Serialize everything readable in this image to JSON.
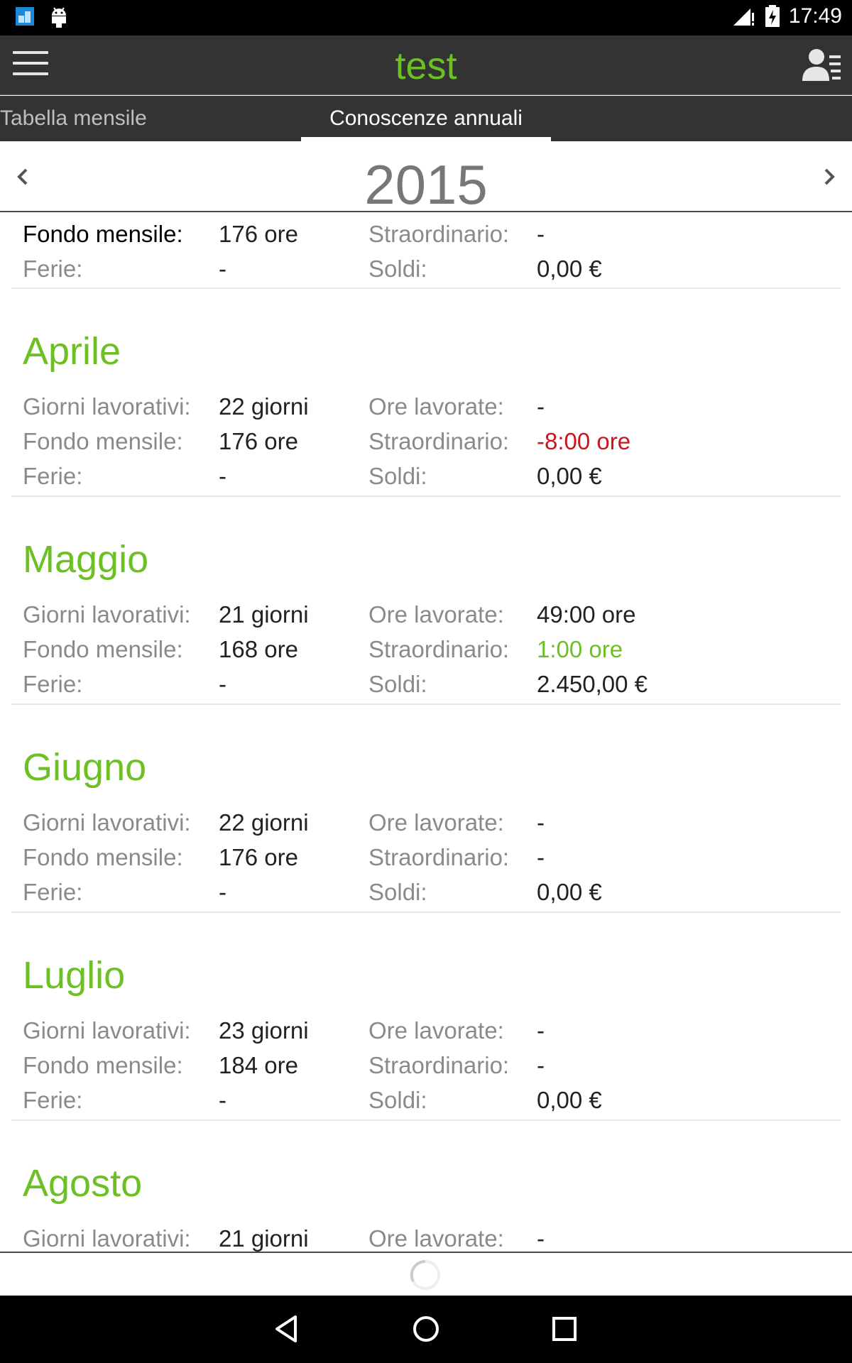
{
  "status_bar": {
    "time": "17:49",
    "icons": [
      "app-icon",
      "android-icon",
      "signal-icon",
      "battery-charging-icon"
    ]
  },
  "app_bar": {
    "title": "test",
    "menu_icon": "menu-icon",
    "profile_icon": "profile-list-icon"
  },
  "tabs": [
    {
      "label": "Tabella mensile",
      "active": false
    },
    {
      "label": "Conoscenze annuali",
      "active": true
    }
  ],
  "year_nav": {
    "year": "2015",
    "prev_icon": "chevron-left-icon",
    "next_icon": "chevron-right-icon"
  },
  "partial_month": {
    "rows": [
      {
        "l1": "Fondo mensile:",
        "v1": "176 ore",
        "l2": "Straordinario:",
        "v2": "-"
      },
      {
        "l1": "Ferie:",
        "v1": "-",
        "l2": "Soldi:",
        "v2": "0,00 €"
      }
    ]
  },
  "months": [
    {
      "name": "Aprile",
      "rows": [
        {
          "l1": "Giorni lavorativi:",
          "v1": "22 giorni",
          "l2": "Ore lavorate:",
          "v2": "-"
        },
        {
          "l1": "Fondo mensile:",
          "v1": "176 ore",
          "l2": "Straordinario:",
          "v2": "-8:00 ore",
          "v2_color": "red"
        },
        {
          "l1": "Ferie:",
          "v1": "-",
          "l2": "Soldi:",
          "v2": "0,00 €"
        }
      ]
    },
    {
      "name": "Maggio",
      "rows": [
        {
          "l1": "Giorni lavorativi:",
          "v1": "21 giorni",
          "l2": "Ore lavorate:",
          "v2": "49:00 ore"
        },
        {
          "l1": "Fondo mensile:",
          "v1": "168 ore",
          "l2": "Straordinario:",
          "v2": "1:00 ore",
          "v2_color": "green"
        },
        {
          "l1": "Ferie:",
          "v1": "-",
          "l2": "Soldi:",
          "v2": "2.450,00 €"
        }
      ]
    },
    {
      "name": "Giugno",
      "rows": [
        {
          "l1": "Giorni lavorativi:",
          "v1": "22 giorni",
          "l2": "Ore lavorate:",
          "v2": "-"
        },
        {
          "l1": "Fondo mensile:",
          "v1": "176 ore",
          "l2": "Straordinario:",
          "v2": "-"
        },
        {
          "l1": "Ferie:",
          "v1": "-",
          "l2": "Soldi:",
          "v2": "0,00 €"
        }
      ]
    },
    {
      "name": "Luglio",
      "rows": [
        {
          "l1": "Giorni lavorativi:",
          "v1": "23 giorni",
          "l2": "Ore lavorate:",
          "v2": "-"
        },
        {
          "l1": "Fondo mensile:",
          "v1": "184 ore",
          "l2": "Straordinario:",
          "v2": "-"
        },
        {
          "l1": "Ferie:",
          "v1": "-",
          "l2": "Soldi:",
          "v2": "0,00 €"
        }
      ]
    },
    {
      "name": "Agosto",
      "rows": [
        {
          "l1": "Giorni lavorativi:",
          "v1": "21 giorni",
          "l2": "Ore lavorate:",
          "v2": "-"
        }
      ]
    }
  ],
  "colors": {
    "accent": "#6cc024",
    "negative": "#c8161d",
    "toolbar": "#333333"
  },
  "nav_bar": {
    "icons": [
      "back-icon",
      "home-icon",
      "recents-icon"
    ]
  }
}
